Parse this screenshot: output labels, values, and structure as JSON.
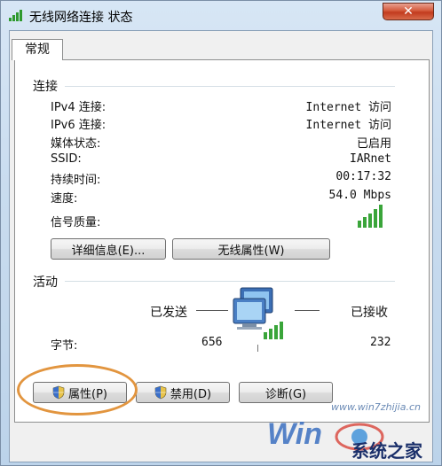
{
  "window": {
    "title": "无线网络连接 状态",
    "close_label": "✕"
  },
  "tab": {
    "label": "常规"
  },
  "connection": {
    "section_title": "连接",
    "rows": [
      {
        "label": "IPv4 连接:",
        "value": "Internet 访问"
      },
      {
        "label": "IPv6 连接:",
        "value": "Internet 访问"
      },
      {
        "label": "媒体状态:",
        "value": "已启用"
      },
      {
        "label": "SSID:",
        "value": "IARnet"
      },
      {
        "label": "持续时间:",
        "value": "00:17:32"
      },
      {
        "label": "速度:",
        "value": "54.0 Mbps"
      }
    ],
    "signal_label": "信号质量:",
    "details_button": "详细信息(E)...",
    "wireless_props_button": "无线属性(W)"
  },
  "activity": {
    "section_title": "活动",
    "sent_label": "已发送",
    "received_label": "已接收",
    "bytes_label": "字节:",
    "bytes_sent": "656",
    "bytes_received": "232"
  },
  "buttons": {
    "properties": "属性(P)",
    "disable": "禁用(D)",
    "diagnose": "诊断(G)"
  },
  "watermark": {
    "url": "www.win7zhijia.cn",
    "brand": "系统之家"
  },
  "colors": {
    "highlight": "#e2953f",
    "signal_green": "#3aa53a"
  }
}
